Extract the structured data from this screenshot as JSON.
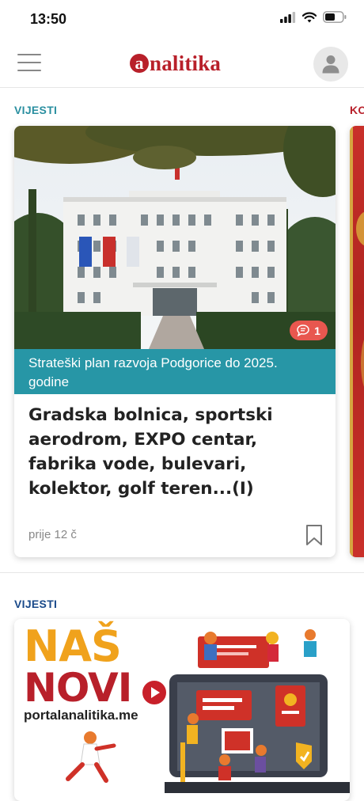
{
  "status_bar": {
    "time": "13:50"
  },
  "app": {
    "logo_letter": "a",
    "logo_text": "nalitika"
  },
  "feed": {
    "section1_label": "VIJESTI",
    "section1_color": "#2a8fa0",
    "next_section_label": "KO",
    "next_section_color": "#b8202a",
    "card": {
      "category": "Strateški plan razvoja Podgorice do 2025. godine",
      "title": "Gradska bolnica, sportski aerodrom, EXPO centar, fabrika vode, bulevari, kolektor, golf teren...(I)",
      "time": "prije 12 č",
      "comments": "1"
    },
    "section2_label": "VIJESTI",
    "section2_color": "#1a4a8a",
    "promo": {
      "line1": "NAŠ",
      "line2": "NOVI",
      "url": "portalanalitika.me"
    }
  }
}
